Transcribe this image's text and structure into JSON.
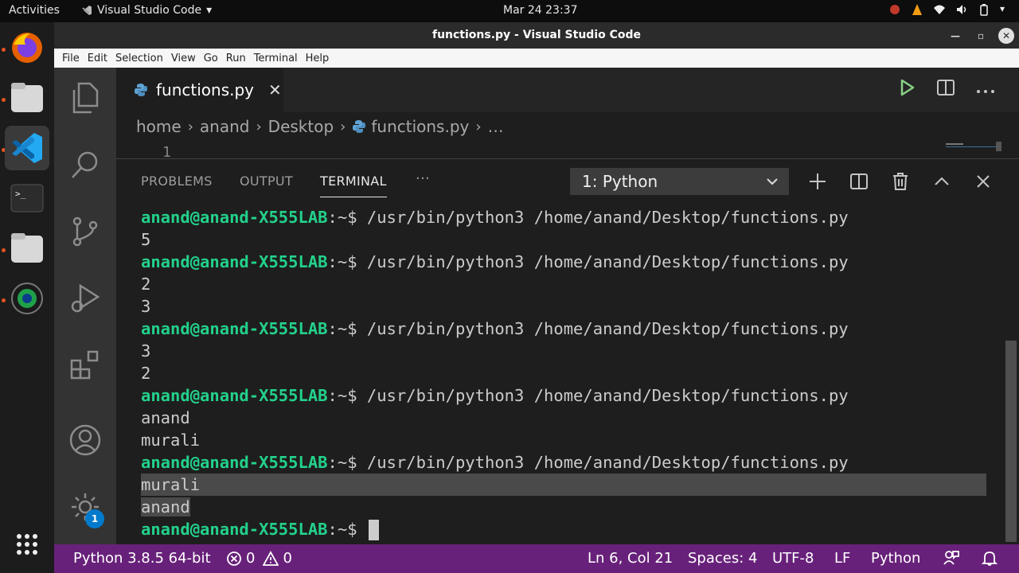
{
  "topbar": {
    "activities": "Activities",
    "app_name": "Visual Studio Code",
    "clock": "Mar 24  23:37"
  },
  "window": {
    "title": "functions.py - Visual Studio Code"
  },
  "menu": [
    "File",
    "Edit",
    "Selection",
    "View",
    "Go",
    "Run",
    "Terminal",
    "Help"
  ],
  "editor": {
    "tab_label": "functions.py",
    "breadcrumb": [
      "home",
      "anand",
      "Desktop",
      "functions.py",
      "…"
    ],
    "peek_line_number": "1"
  },
  "panel": {
    "tabs": [
      "PROBLEMS",
      "OUTPUT",
      "TERMINAL"
    ],
    "more": "···",
    "terminal_select": "1: Python",
    "prompt_user": "anand@anand-X555LAB",
    "prompt_path": ":~",
    "prompt_symbol": "$ ",
    "command": "/usr/bin/python3 /home/anand/Desktop/functions.py",
    "outputs": [
      [
        "5"
      ],
      [
        "2",
        "3"
      ],
      [
        "3",
        "2"
      ],
      [
        "anand",
        "murali"
      ],
      [
        "murali",
        "anand"
      ]
    ]
  },
  "statusbar": {
    "interpreter": "Python 3.8.5 64-bit",
    "errors": "0",
    "warnings": "0",
    "position": "Ln 6, Col 21",
    "spaces": "Spaces: 4",
    "encoding": "UTF-8",
    "eol": "LF",
    "language": "Python"
  },
  "activity": {
    "settings_badge": "1"
  },
  "colors": {
    "statusbar": "#68217a",
    "prompt_user": "#23d18b",
    "prompt_path": "#3b8eea",
    "run_icon": "#89d185"
  }
}
